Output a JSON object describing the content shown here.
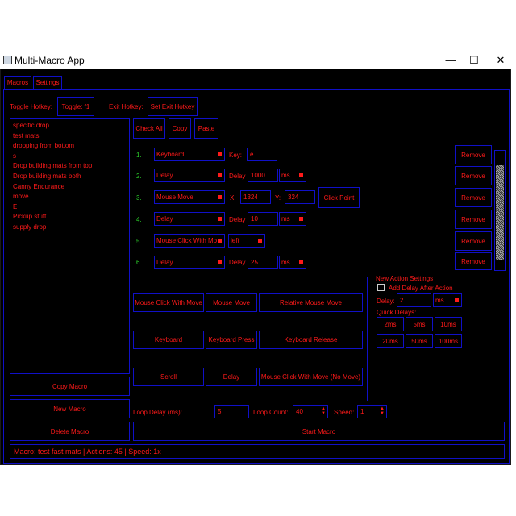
{
  "window": {
    "title": "Multi-Macro App",
    "min": "—",
    "max": "☐",
    "close": "✕"
  },
  "tabs": [
    "Macros",
    "Settings"
  ],
  "hotkeys": {
    "toggle_label": "Toggle Hotkey:",
    "toggle_value": "Toggle: f1",
    "exit_label": "Exit Hotkey:",
    "exit_value": "Set Exit Hotkey"
  },
  "macros": [
    "specific drop",
    "test mats",
    "dropping from bottom",
    "s",
    "Drop building mats from top",
    " Drop building mats both",
    "Canny Endurance",
    "move",
    "E",
    "Pickup stuff",
    "supply drop"
  ],
  "toolbar": {
    "check_all": "Check All",
    "copy": "Copy",
    "paste": "Paste"
  },
  "actions": [
    {
      "num": "1.",
      "type": "Keyboard",
      "f1_label": "Key:",
      "f1_value": "e",
      "remove": "Remove"
    },
    {
      "num": "2.",
      "type": "Delay",
      "f1_label": "Delay",
      "f1_value": "1000",
      "unit": "ms",
      "remove": "Remove"
    },
    {
      "num": "3.",
      "type": "Mouse Move",
      "f1_label": "X:",
      "f1_value": "1324",
      "f2_label": "Y:",
      "f2_value": "324",
      "extra": "Click Point",
      "remove": "Remove"
    },
    {
      "num": "4.",
      "type": "Delay",
      "f1_label": "Delay",
      "f1_value": "10",
      "unit": "ms",
      "remove": "Remove"
    },
    {
      "num": "5.",
      "type": "Mouse Click With Mo",
      "f1_value": "left",
      "remove": "Remove"
    },
    {
      "num": "6.",
      "type": "Delay",
      "f1_label": "Delay",
      "f1_value": "25",
      "unit": "ms",
      "remove": "Remove"
    }
  ],
  "add_buttons": [
    [
      "Mouse Click With Move",
      "Mouse Move",
      "Relative Mouse Move"
    ],
    [
      "Keyboard",
      "Keyboard Press",
      "Keyboard Release"
    ],
    [
      "Scroll",
      "Delay",
      "Mouse Click With Move (No Move)"
    ]
  ],
  "new_action": {
    "title": "New Action Settings",
    "add_delay_label": "Add Delay After Action",
    "delay_label": "Delay:",
    "delay_value": "2",
    "delay_unit": "ms",
    "quick_label": "Quick Delays:",
    "quick": [
      "2ms",
      "5ms",
      "10ms",
      "20ms",
      "50ms",
      "100ms"
    ]
  },
  "left_buttons": {
    "copy_macro": "Copy Macro",
    "new_macro": "New Macro",
    "delete_macro": "Delete Macro"
  },
  "loop": {
    "delay_label": "Loop Delay (ms):",
    "delay_value": "5",
    "count_label": "Loop Count:",
    "count_value": "40",
    "speed_label": "Speed:",
    "speed_value": "1"
  },
  "start": "Start Macro",
  "status": "Macro: test fast mats | Actions: 45 | Speed: 1x",
  "colors": {
    "text": "#ff1a1a",
    "border": "#1010c8",
    "index": "#2bd12b",
    "bg": "#000000"
  }
}
